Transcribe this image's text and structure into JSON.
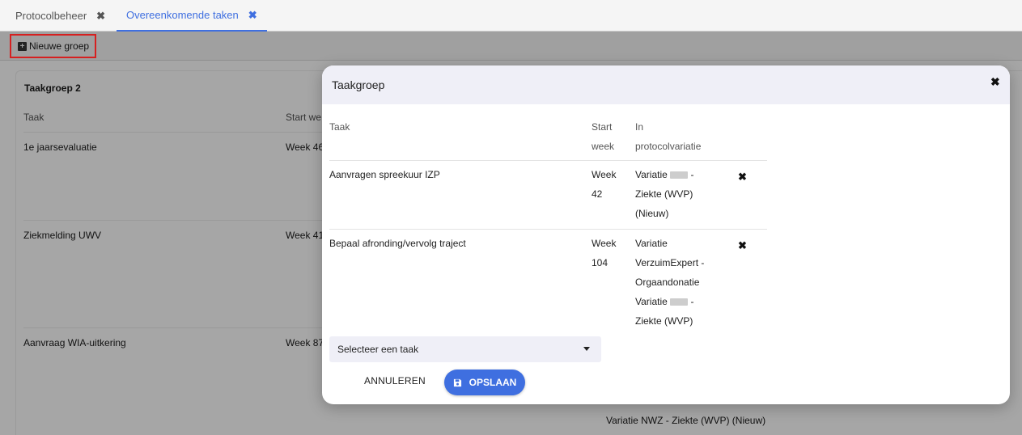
{
  "tabs": [
    {
      "label": "Protocolbeheer",
      "close": "✖"
    },
    {
      "label": "Overeenkomende taken",
      "close": "✖"
    }
  ],
  "toolbar": {
    "new_group_label": "Nieuwe groep",
    "plus_glyph": "+"
  },
  "background": {
    "group_title": "Taakgroep 2",
    "col_task": "Taak",
    "col_start": "Start we",
    "rows": [
      {
        "task": "1e jaarsevaluatie",
        "week": "Week 46"
      },
      {
        "task": "Ziekmelding UWV",
        "week": "Week 41"
      },
      {
        "task": "Aanvraag WIA-uitkering",
        "week": "Week 87"
      }
    ],
    "footer_variation": "Variatie NWZ - Ziekte (WVP) (Nieuw)"
  },
  "modal": {
    "title": "Taakgroep",
    "close": "✖",
    "columns": {
      "task": "Taak",
      "start_1": "Start",
      "start_2": "week",
      "in_1": "In",
      "in_2": "protocolvariatie"
    },
    "rows": [
      {
        "task": "Aanvragen spreekuur IZP",
        "week_1": "Week",
        "week_2": "42",
        "var_1_prefix": "Variatie",
        "var_1_suffix": "-",
        "var_2": "Ziekte (WVP)",
        "var_3": "(Nieuw)",
        "remove": "✖"
      },
      {
        "task": "Bepaal afronding/vervolg traject",
        "week_1": "Week",
        "week_2": "104",
        "var_1": "Variatie",
        "var_2": "VerzuimExpert -",
        "var_3": "Orgaandonatie",
        "var_4_prefix": "Variatie",
        "var_4_suffix": "-",
        "var_5": "Ziekte (WVP)",
        "remove": "✖"
      }
    ],
    "select_placeholder": "Selecteer een taak",
    "cancel_label": "ANNULEREN",
    "save_label": "OPSLAAN"
  },
  "colors": {
    "accent": "#3f6fe0",
    "highlight_border": "#d62020"
  }
}
